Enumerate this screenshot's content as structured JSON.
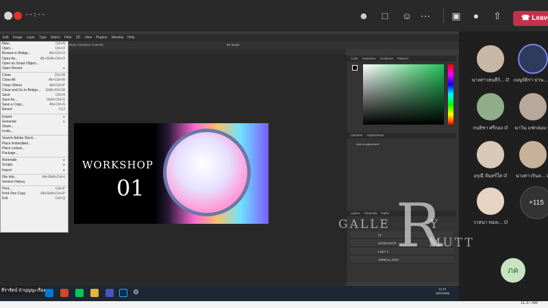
{
  "teams": {
    "timer": "--:--",
    "leave_label": "Leave",
    "colors": {
      "bar": "#292929",
      "leave": "#c4314b",
      "record": "#e0352b"
    },
    "icons": [
      "people-icon",
      "chat-icon",
      "reactions-icon",
      "more-icon",
      "camera-off-icon",
      "mic-icon",
      "share-icon"
    ]
  },
  "photoshop": {
    "menubar": [
      "Edit",
      "Image",
      "Layer",
      "Type",
      "Select",
      "Filter",
      "3D",
      "View",
      "Plugins",
      "Window",
      "Help"
    ],
    "options_text": "Show Transform Controls",
    "mode_3d": "3D Mode:",
    "file_menu": [
      {
        "label": "New...",
        "shortcut": "Ctrl+N"
      },
      {
        "label": "Open...",
        "shortcut": "Ctrl+O"
      },
      {
        "label": "Browse in Bridge...",
        "shortcut": "Alt+Ctrl+O"
      },
      {
        "label": "Open As...",
        "shortcut": "Alt+Shift+Ctrl+O"
      },
      {
        "label": "Open as Smart Object...",
        "shortcut": ""
      },
      {
        "label": "Open Recent",
        "shortcut": "▸"
      },
      {
        "label": "Close",
        "shortcut": "Ctrl+W"
      },
      {
        "label": "Close All",
        "shortcut": "Alt+Ctrl+W"
      },
      {
        "label": "Close Others",
        "shortcut": "Alt+Ctrl+P"
      },
      {
        "label": "Close and Go to Bridge...",
        "shortcut": "Shift+Ctrl+W"
      },
      {
        "label": "Save",
        "shortcut": "Ctrl+S"
      },
      {
        "label": "Save As...",
        "shortcut": "Shift+Ctrl+S"
      },
      {
        "label": "Save a Copy...",
        "shortcut": "Alt+Ctrl+S"
      },
      {
        "label": "Revert",
        "shortcut": "F12"
      },
      {
        "label": "Export",
        "shortcut": "▸"
      },
      {
        "label": "Generate",
        "shortcut": "▸"
      },
      {
        "label": "Share...",
        "shortcut": ""
      },
      {
        "label": "Invite...",
        "shortcut": ""
      },
      {
        "label": "Search Adobe Stock...",
        "shortcut": ""
      },
      {
        "label": "Place Embedded...",
        "shortcut": ""
      },
      {
        "label": "Place Linked...",
        "shortcut": ""
      },
      {
        "label": "Package...",
        "shortcut": ""
      },
      {
        "label": "Automate",
        "shortcut": "▸"
      },
      {
        "label": "Scripts",
        "shortcut": "▸"
      },
      {
        "label": "Import",
        "shortcut": "▸"
      },
      {
        "label": "File Info...",
        "shortcut": "Alt+Shift+Ctrl+I"
      },
      {
        "label": "Version History",
        "shortcut": ""
      },
      {
        "label": "Print...",
        "shortcut": "Ctrl+P"
      },
      {
        "label": "Print One Copy",
        "shortcut": "Alt+Shift+Ctrl+P"
      },
      {
        "label": "Exit",
        "shortcut": "Ctrl+Q"
      }
    ],
    "artwork": {
      "title": "WORKSHOP",
      "number": "01"
    },
    "panel_tabs_top": [
      "Color",
      "Swatches",
      "Gradients",
      "Patterns"
    ],
    "panel_tabs_mid": [
      "Libraries",
      "Adjustments"
    ],
    "adjust_hint": "Add an adjustment",
    "panel_tabs_layers": [
      "Layers",
      "Channels",
      "Paths"
    ],
    "layers": [
      "01",
      "WORKSHOP",
      "Layer 1",
      "1589mw_2020"
    ],
    "taskbar_time": "11:37",
    "taskbar_date": "29/1/2565"
  },
  "presenter_name": "ธีรารัตน์ ป่าบุญญะเรือง",
  "watermark": {
    "top": "GALLE",
    "big": "R",
    "right": "Y",
    "bottom": "MUTT"
  },
  "participants": [
    {
      "name": "นางสาวธนธีร์..."
    },
    {
      "name": "เบญจ์ธิรา ปาน..."
    },
    {
      "name": "กนธิชา ศรีกอง"
    },
    {
      "name": "นาวิน แซ่กล่อม"
    },
    {
      "name": "อรุณี จันทร์ใส"
    },
    {
      "name": "นางสาวรินล..."
    },
    {
      "name": "วาสนา ทองเ..."
    }
  ],
  "more_participants": "+115",
  "self_initials": "ภค",
  "system_clock": "11:37 AM"
}
